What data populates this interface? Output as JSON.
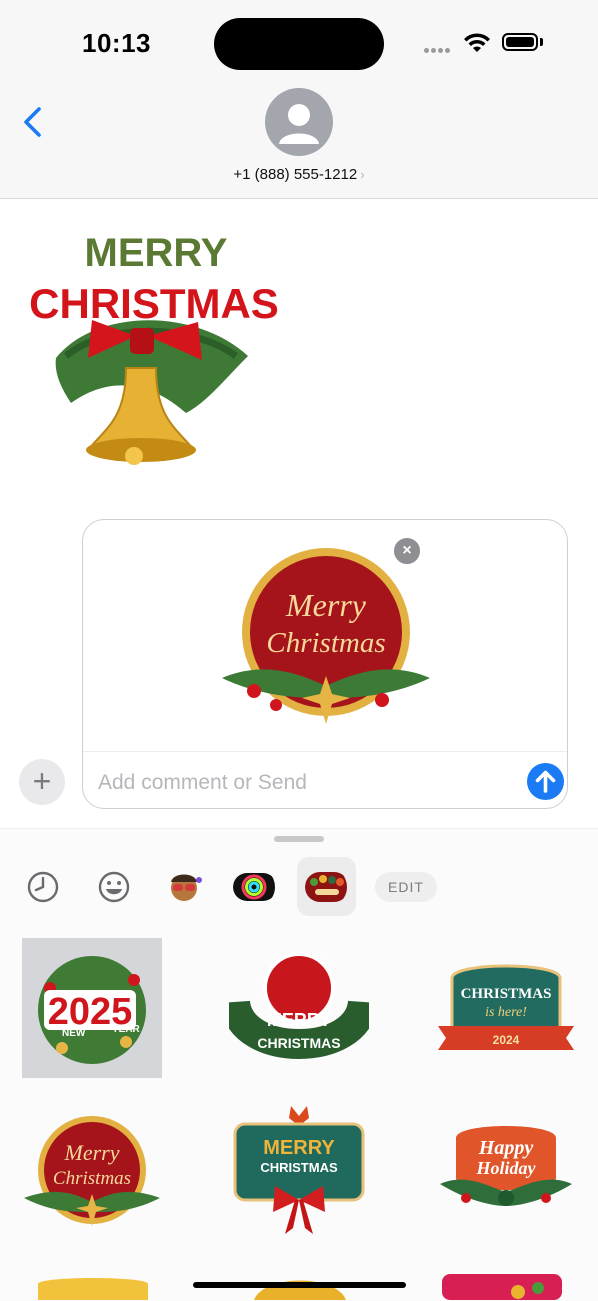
{
  "status": {
    "time": "10:13"
  },
  "contact": {
    "phone": "+1 (888) 555-1212",
    "chevron": "›"
  },
  "sent_sticker": {
    "line1": "MERRY",
    "line2": "CHRISTMAS"
  },
  "compose": {
    "sticker_line1": "Merry",
    "sticker_line2": "Christmas",
    "placeholder": "Add comment or Send",
    "remove_symbol": "×"
  },
  "plus_symbol": "+",
  "drawer": {
    "tabs": [
      "recents-icon",
      "emoji-icon",
      "memoji-icon",
      "activity-rings-icon",
      "sticker-pack-icon"
    ],
    "edit_label": "EDIT",
    "stickers": [
      {
        "name": "sticker-2025",
        "big": "2025",
        "left": "NEW",
        "right": "YEAR"
      },
      {
        "name": "sticker-merry-christmas-wreath",
        "top": "MERRY",
        "bottom": "CHRISTMAS"
      },
      {
        "name": "sticker-christmas-is-here",
        "l1": "CHRISTMAS",
        "l2": "is here!",
        "l3": "2024"
      },
      {
        "name": "sticker-merry-christmas-round",
        "l1": "Merry",
        "l2": "Christmas"
      },
      {
        "name": "sticker-merry-christmas-sign",
        "l1": "MERRY",
        "l2": "CHRISTMAS"
      },
      {
        "name": "sticker-happy-holiday",
        "l1": "Happy",
        "l2": "Holiday"
      }
    ]
  },
  "colors": {
    "accent": "#1a7bf5",
    "christmas_red": "#c8161d",
    "christmas_green": "#2f6b3a",
    "gold": "#e8b430"
  }
}
